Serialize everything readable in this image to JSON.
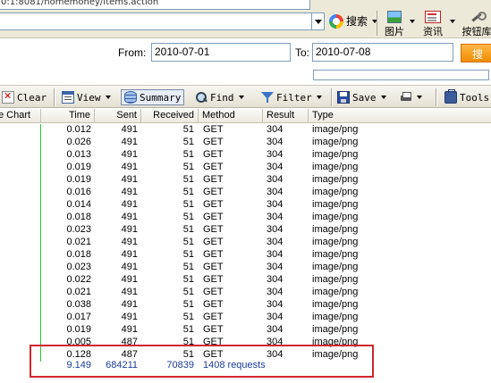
{
  "browser": {
    "address_text": "0:1:8081/homemoney/Items.action",
    "search_label": "搜索",
    "images_label": "图片",
    "news_label": "资讯",
    "buttons_label": "按钮库"
  },
  "filter": {
    "from_label": "From:",
    "from_value": "2010-07-01",
    "to_label": "To:",
    "to_value": "2010-07-08",
    "search_button": "搜"
  },
  "toolbar": {
    "clear": "Clear",
    "view": "View",
    "summary": "Summary",
    "find": "Find",
    "filter": "Filter",
    "save": "Save",
    "tools": "Tools"
  },
  "columns": [
    "e Chart",
    "Time",
    "Sent",
    "Received",
    "Method",
    "Result",
    "Type"
  ],
  "rows": [
    {
      "time": "0.012",
      "sent": "491",
      "received": "51",
      "method": "GET",
      "result": "304",
      "type": "image/png"
    },
    {
      "time": "0.026",
      "sent": "491",
      "received": "51",
      "method": "GET",
      "result": "304",
      "type": "image/png"
    },
    {
      "time": "0.013",
      "sent": "491",
      "received": "51",
      "method": "GET",
      "result": "304",
      "type": "image/png"
    },
    {
      "time": "0.019",
      "sent": "491",
      "received": "51",
      "method": "GET",
      "result": "304",
      "type": "image/png"
    },
    {
      "time": "0.019",
      "sent": "491",
      "received": "51",
      "method": "GET",
      "result": "304",
      "type": "image/png"
    },
    {
      "time": "0.016",
      "sent": "491",
      "received": "51",
      "method": "GET",
      "result": "304",
      "type": "image/png"
    },
    {
      "time": "0.014",
      "sent": "491",
      "received": "51",
      "method": "GET",
      "result": "304",
      "type": "image/png"
    },
    {
      "time": "0.018",
      "sent": "491",
      "received": "51",
      "method": "GET",
      "result": "304",
      "type": "image/png"
    },
    {
      "time": "0.023",
      "sent": "491",
      "received": "51",
      "method": "GET",
      "result": "304",
      "type": "image/png"
    },
    {
      "time": "0.021",
      "sent": "491",
      "received": "51",
      "method": "GET",
      "result": "304",
      "type": "image/png"
    },
    {
      "time": "0.018",
      "sent": "491",
      "received": "51",
      "method": "GET",
      "result": "304",
      "type": "image/png"
    },
    {
      "time": "0.023",
      "sent": "491",
      "received": "51",
      "method": "GET",
      "result": "304",
      "type": "image/png"
    },
    {
      "time": "0.022",
      "sent": "491",
      "received": "51",
      "method": "GET",
      "result": "304",
      "type": "image/png"
    },
    {
      "time": "0.021",
      "sent": "491",
      "received": "51",
      "method": "GET",
      "result": "304",
      "type": "image/png"
    },
    {
      "time": "0.038",
      "sent": "491",
      "received": "51",
      "method": "GET",
      "result": "304",
      "type": "image/png"
    },
    {
      "time": "0.017",
      "sent": "491",
      "received": "51",
      "method": "GET",
      "result": "304",
      "type": "image/png"
    },
    {
      "time": "0.019",
      "sent": "491",
      "received": "51",
      "method": "GET",
      "result": "304",
      "type": "image/png"
    },
    {
      "time": "0.005",
      "sent": "487",
      "received": "51",
      "method": "GET",
      "result": "304",
      "type": "image/png"
    },
    {
      "time": "0.128",
      "sent": "487",
      "received": "51",
      "method": "GET",
      "result": "304",
      "type": "image/png"
    }
  ],
  "totals": {
    "time": "9.149",
    "sent": "684211",
    "received": "70839",
    "requests": "1408 requests"
  },
  "colors": {
    "highlight": "#d0262e",
    "total_text": "#1a3c9c",
    "timeline_tick": "#2ec22e",
    "search_button": "#f08c00"
  }
}
